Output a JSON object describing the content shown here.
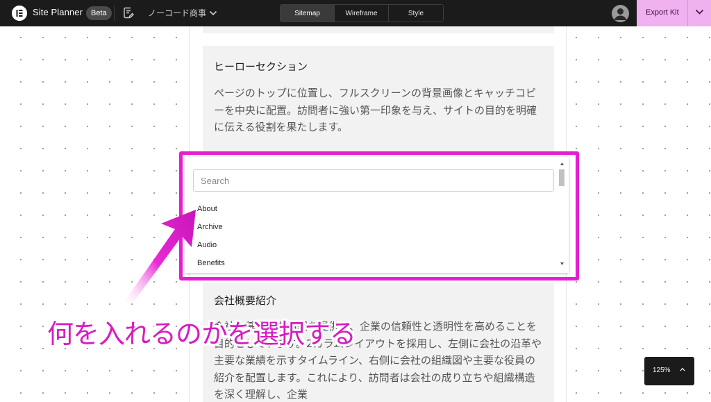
{
  "topbar": {
    "app_title": "Site Planner",
    "badge": "Beta",
    "project_name": "ノーコード商事",
    "tabs": [
      {
        "label": "Sitemap",
        "active": true
      },
      {
        "label": "Wireframe",
        "active": false
      },
      {
        "label": "Style",
        "active": false
      }
    ],
    "export_label": "Export Kit"
  },
  "sections": {
    "hero": {
      "title": "ヒーローセクション",
      "description": "ページのトップに位置し、フルスクリーンの背景画像とキャッチコピーを中央に配置。訪問者に強い第一印象を与え、サイトの目的を明確に伝える役割を果たします。"
    },
    "company": {
      "title": "会社概要紹介",
      "description": "会社の基本的な情報を提供し、企業の信頼性と透明性を高めることを目的としています。2カラムレイアウトを採用し、左側に会社の沿革や主要な業績を示すタイムライン、右側に会社の組織図や主要な役員の紹介を配置します。これにより、訪問者は会社の成り立ちや組織構造を深く理解し、企業"
    }
  },
  "dropdown": {
    "search_placeholder": "Search",
    "options": [
      "About",
      "Archive",
      "Audio",
      "Benefits"
    ]
  },
  "annotation": "何を入れるのかを選択する",
  "zoom": "125%",
  "colors": {
    "topbar": "#1b1b1b",
    "export_button": "#f0b1f1",
    "highlight": "#e51ecf",
    "annotation": "#d61cc0"
  }
}
